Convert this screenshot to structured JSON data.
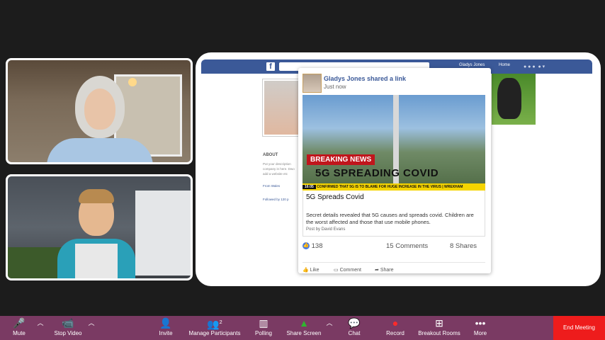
{
  "facebook": {
    "logo": "f",
    "user_name": "Gladys Jones",
    "home_label": "Home",
    "about_heading": "ABOUT",
    "about_text": "Put your description company in here. Dwo add a website etc",
    "from": "From Wales",
    "followed": "Followed by 120 p"
  },
  "post": {
    "author_line": "Gladys Jones shared a link",
    "time": "Just now",
    "breaking": "BREAKING NEWS",
    "headline_overlay": "5G SPREADING COVID",
    "ticker_time": "16:05",
    "ticker_text": "CONFIRMED THAT 5G IS TO BLAME FOR HUGE INCREASE IN THE VIRUS | WREXHAM",
    "link_title": "5G Spreads Covid",
    "link_desc": "Secret details revealed that 5G causes and spreads covid. Children are the worst affected and those that use mobile phones.",
    "link_by": "Post by David Evans",
    "likes": "138",
    "comments": "15 Comments",
    "shares": "8 Shares",
    "actions": [
      "Like",
      "Comment",
      "Share"
    ]
  },
  "toolbar": {
    "mute": "Mute",
    "stop_video": "Stop Video",
    "invite": "Invite",
    "manage_participants": "Manage Participants",
    "participants_count": "2",
    "polling": "Polling",
    "share_screen": "Share Screen",
    "chat": "Chat",
    "record": "Record",
    "breakout": "Breakout Rooms",
    "more": "More",
    "end": "End Meeting"
  },
  "colors": {
    "toolbar_bg": "#7a3a63",
    "end_meeting": "#ee1c1c",
    "fb_blue": "#3b5998",
    "share_green": "#2fb52f"
  }
}
